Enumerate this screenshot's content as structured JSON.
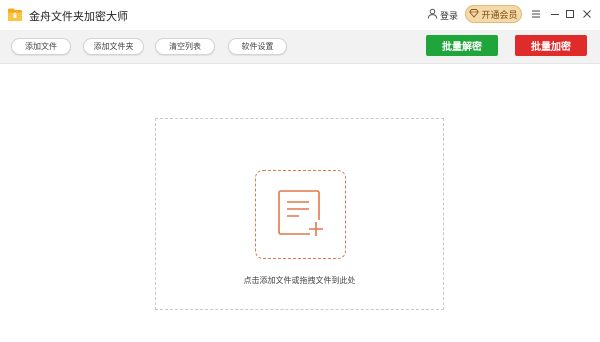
{
  "app": {
    "title": "金舟文件夹加密大师",
    "icon": "folder-logo-icon",
    "brand_color": "#f7b21c"
  },
  "header": {
    "login_label": "登录",
    "vip_label": "开通会员",
    "window_controls": [
      "menu-icon",
      "minimize-icon",
      "maximize-icon",
      "close-icon"
    ]
  },
  "toolbar": {
    "add_file_label": "添加文件",
    "add_folder_label": "添加文件夹",
    "clear_list_label": "清空列表",
    "settings_label": "软件设置",
    "batch_decrypt_label": "批量解密",
    "batch_encrypt_label": "批量加密",
    "decrypt_color": "#1fa53a",
    "encrypt_color": "#e02b2b"
  },
  "main": {
    "drop_hint": "点击添加文件或拖拽文件到此处",
    "drop_icon": "add-document-icon",
    "accent_color": "#e2774f"
  }
}
